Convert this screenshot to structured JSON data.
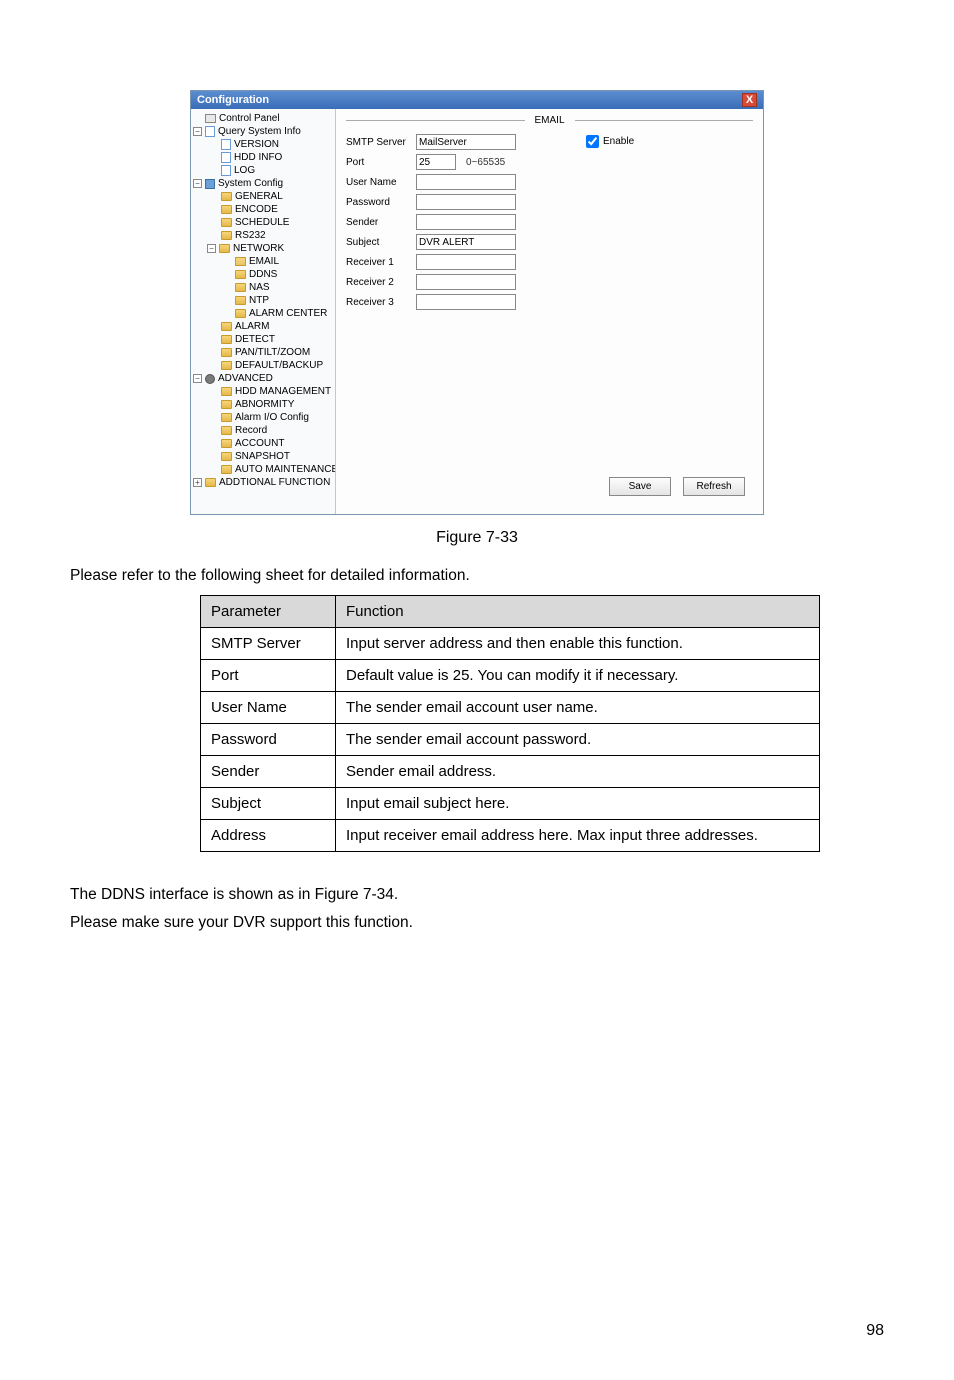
{
  "window": {
    "title": "Configuration"
  },
  "tree": {
    "root": "Control Panel",
    "qsi": "Query System Info",
    "version": "VERSION",
    "hdd": "HDD INFO",
    "log": "LOG",
    "sysconfig": "System Config",
    "general": "GENERAL",
    "encode": "ENCODE",
    "schedule": "SCHEDULE",
    "rs232": "RS232",
    "network": "NETWORK",
    "email": "EMAIL",
    "ddns": "DDNS",
    "nas": "NAS",
    "ntp": "NTP",
    "alarmcenter": "ALARM CENTER",
    "alarm": "ALARM",
    "detect": "DETECT",
    "ptz": "PAN/TILT/ZOOM",
    "defaultbackup": "DEFAULT/BACKUP",
    "advanced": "ADVANCED",
    "hddmgmt": "HDD MANAGEMENT",
    "abnormity": "ABNORMITY",
    "alarmio": "Alarm I/O Config",
    "record": "Record",
    "account": "ACCOUNT",
    "snapshot": "SNAPSHOT",
    "automaint": "AUTO MAINTENANCE",
    "addfunc": "ADDTIONAL FUNCTION"
  },
  "form": {
    "panel_title": "EMAIL",
    "labels": {
      "smtp": "SMTP Server",
      "port": "Port",
      "username": "User Name",
      "password": "Password",
      "sender": "Sender",
      "subject": "Subject",
      "r1": "Receiver 1",
      "r2": "Receiver 2",
      "r3": "Receiver 3",
      "enable": "Enable"
    },
    "values": {
      "smtp": "MailServer",
      "port": "25",
      "port_hint": "0~65535",
      "username": "",
      "password": "",
      "sender": "",
      "subject": "DVR ALERT",
      "r1": "",
      "r2": "",
      "r3": ""
    },
    "buttons": {
      "save": "Save",
      "refresh": "Refresh"
    }
  },
  "figure": "Figure 7-33",
  "intro": "Please refer to the following sheet for detailed information.",
  "table": {
    "headers": {
      "param": "Parameter",
      "func": "Function"
    },
    "rows": [
      {
        "p": "SMTP Server",
        "f": "Input server address and then enable this function."
      },
      {
        "p": "Port",
        "f": "Default value is 25. You can modify it if necessary."
      },
      {
        "p": "User Name",
        "f": "The sender email account user name."
      },
      {
        "p": "Password",
        "f": "The sender email account password."
      },
      {
        "p": "Sender",
        "f": "Sender email address."
      },
      {
        "p": "Subject",
        "f": "Input email subject here."
      },
      {
        "p": "Address",
        "f": "Input receiver email address here. Max input three addresses."
      }
    ]
  },
  "after1": "The DDNS interface is shown as in Figure 7-34.",
  "after2": "Please make sure your DVR support this function.",
  "pagenum": "98"
}
